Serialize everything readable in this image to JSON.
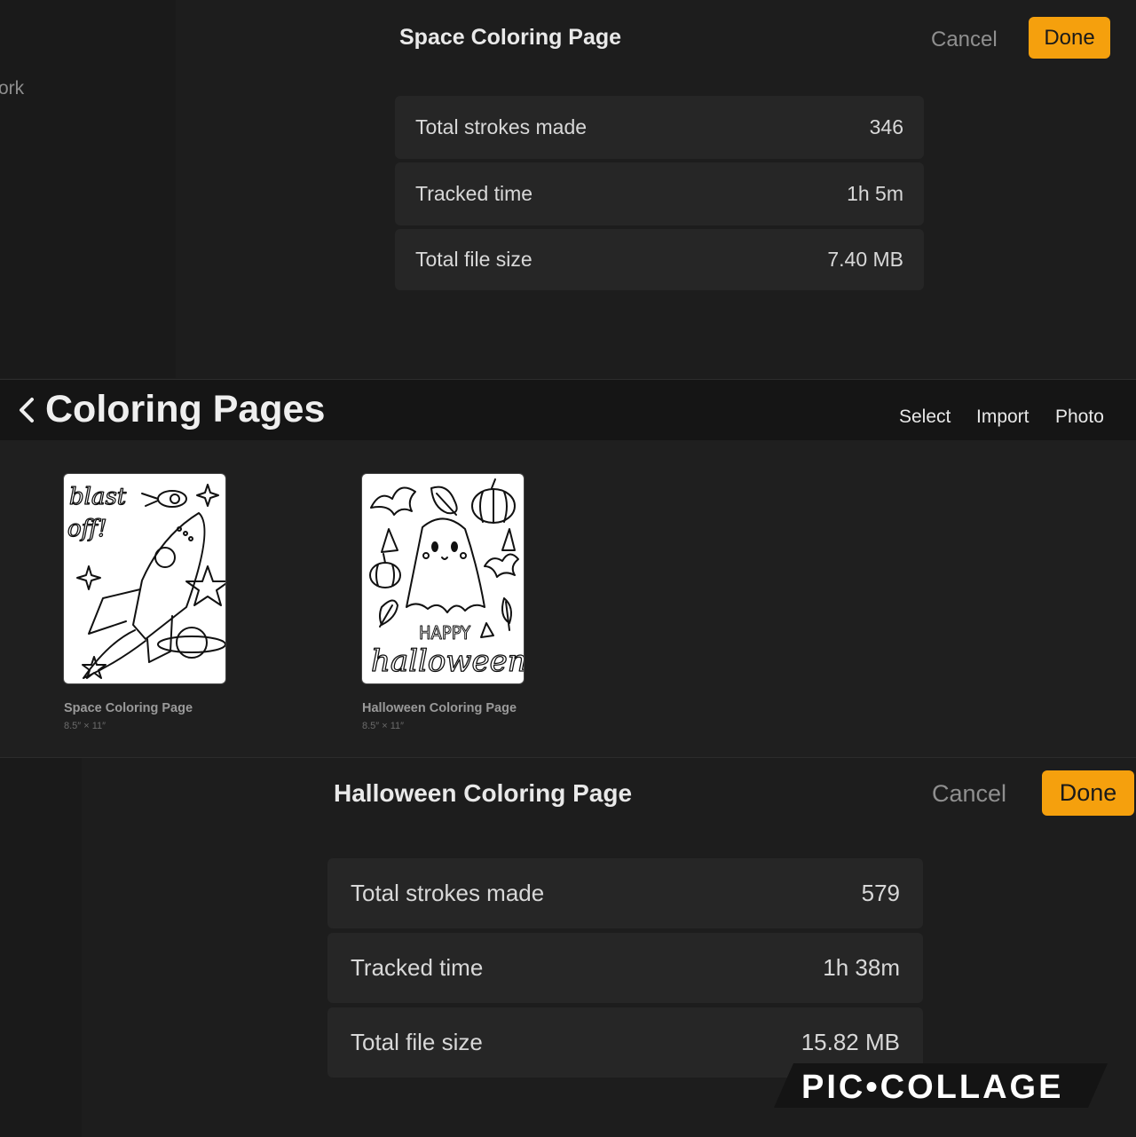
{
  "top_sheet": {
    "sidebar_partial_text": "ork",
    "title": "Space Coloring Page",
    "cancel_label": "Cancel",
    "done_label": "Done",
    "stats": [
      {
        "label": "Total strokes made",
        "value": "346"
      },
      {
        "label": "Tracked time",
        "value": "1h 5m"
      },
      {
        "label": "Total file size",
        "value": "7.40 MB"
      }
    ]
  },
  "gallery": {
    "title": "Coloring Pages",
    "actions": {
      "select": "Select",
      "import": "Import",
      "photo": "Photo"
    },
    "items": [
      {
        "name": "Space Coloring Page",
        "size": "8.5″ × 11″",
        "art_text_1": "blast",
        "art_text_2": "off!"
      },
      {
        "name": "Halloween Coloring Page",
        "size": "8.5″ × 11″",
        "art_text_1": "HAPPY",
        "art_text_2": "halloween"
      }
    ]
  },
  "bottom_sheet": {
    "title": "Halloween Coloring Page",
    "cancel_label": "Cancel",
    "done_label": "Done",
    "stats": [
      {
        "label": "Total strokes made",
        "value": "579"
      },
      {
        "label": "Tracked time",
        "value": "1h 38m"
      },
      {
        "label": "Total file size",
        "value": "15.82 MB"
      }
    ]
  },
  "watermark": {
    "text": "PIC•COLLAGE"
  },
  "colors": {
    "accent": "#f5a00d",
    "background": "#1e1e1e",
    "row": "#262626"
  },
  "icons": [
    "chevron-left-icon"
  ]
}
